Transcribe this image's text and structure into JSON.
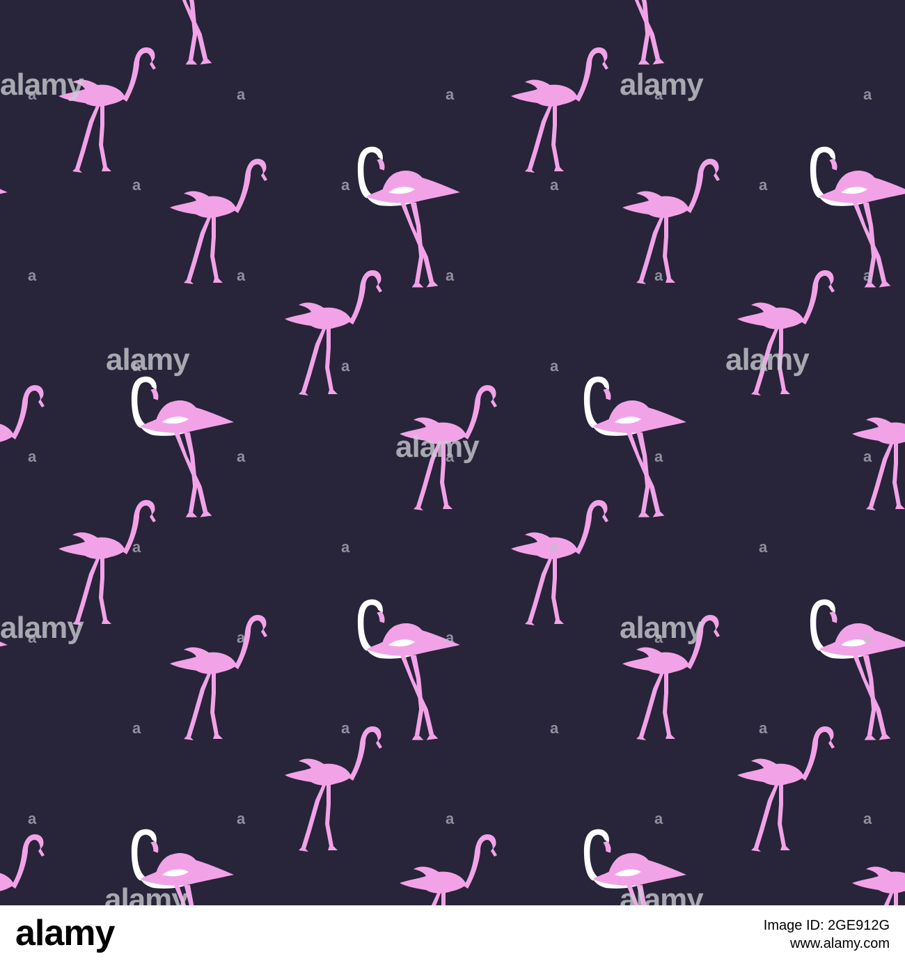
{
  "colors": {
    "background": "#28243a",
    "flamingo_pink": "#f2a3e8",
    "flamingo_light": "#ffffff",
    "footer_bg": "#ffffff",
    "footer_text": "#000000"
  },
  "pattern": {
    "motif": "flamingo-silhouette",
    "variants": [
      "pink-flamingo-icon",
      "white-neck-flamingo-icon"
    ]
  },
  "watermark": {
    "text": "alamy",
    "small": "a"
  },
  "footer": {
    "logo": "alamy",
    "image_id": "Image ID: 2GE912G",
    "url": "www.alamy.com"
  }
}
